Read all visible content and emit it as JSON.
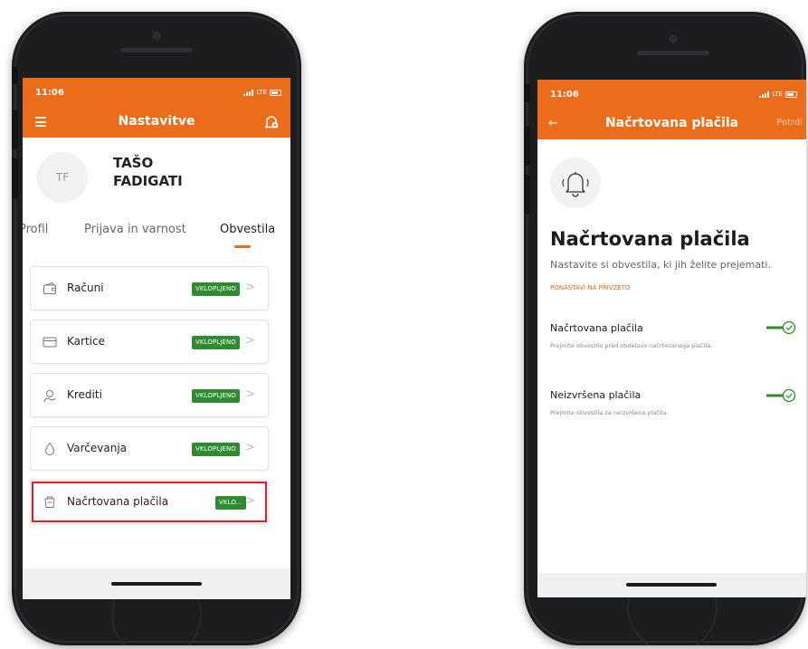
{
  "left_phone": {
    "status_time": "11:06",
    "network": "LTE",
    "title": "Nastavitve",
    "avatar_initials": "TF",
    "user_name": "TAŠO FADIGATI",
    "tabs": [
      "Profil",
      "Prijava in varnost",
      "Obvestila"
    ],
    "active_tab": "Obvestila",
    "items": [
      {
        "label": "Računi",
        "badge": "VKLOPLJENO",
        "icon": "wallet-icon"
      },
      {
        "label": "Kartice",
        "badge": "VKLOPLJENO",
        "icon": "card-icon"
      },
      {
        "label": "Krediti",
        "badge": "VKLOPLJENO",
        "icon": "loan-icon"
      },
      {
        "label": "Varčevanja",
        "badge": "VKLOPLJENO",
        "icon": "savings-drop-icon"
      },
      {
        "label": "Načrtovana plačila",
        "badge": "VKLO...",
        "icon": "scheduled-payment-icon"
      }
    ],
    "highlighted_item": "Načrtovana plačila"
  },
  "right_phone": {
    "status_time": "11:06",
    "network": "LTE",
    "title": "Načrtovana plačila",
    "action_label": "Potrdi",
    "page_title": "Načrtovana plačila",
    "subtitle": "Nastavite si obvestila, ki jih želite prejemati.",
    "reset_link": "PONASTAVI NA PRIVZETO",
    "settings": [
      {
        "title": "Načrtovana plačila",
        "description": "Prejmite obvestilo pred obdelavo načrtovanega plačila.",
        "enabled": true
      },
      {
        "title": "Neizvršena plačila",
        "description": "Prejmite obvestila za neizvršena plačila.",
        "enabled": true
      }
    ]
  },
  "colors": {
    "brand_orange": "#eb6d1c",
    "badge_green": "#2e8b30",
    "highlight_red": "#e31c23",
    "toggle_green": "#2e8b30"
  }
}
